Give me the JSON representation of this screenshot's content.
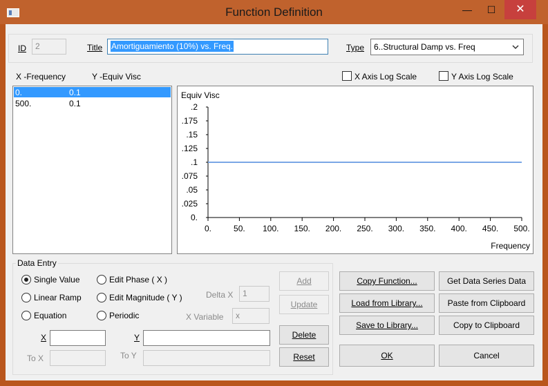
{
  "window": {
    "title": "Function Definition",
    "minimize_glyph": "—",
    "maximize_glyph": "☐",
    "close_glyph": "✕"
  },
  "header": {
    "id_label": "ID",
    "id_value": "2",
    "title_label": "Title",
    "title_value": "Amortiguamiento (10%) vs. Freq.",
    "type_label": "Type",
    "type_value": "6..Structural Damp vs. Freq"
  },
  "list": {
    "x_header": "X -Frequency",
    "y_header": "Y -Equiv Visc",
    "rows": [
      {
        "x": "0.",
        "y": "0.1"
      },
      {
        "x": "500.",
        "y": "0.1"
      }
    ],
    "selected_index": 0
  },
  "log_scale": {
    "x_label": "X Axis Log Scale",
    "x_checked": false,
    "y_label": "Y Axis Log Scale",
    "y_checked": false
  },
  "chart_data": {
    "type": "line",
    "title": "",
    "ylabel": "Equiv Visc",
    "xlabel": "Frequency",
    "x_ticks": [
      "0.",
      "50.",
      "100.",
      "150.",
      "200.",
      "250.",
      "300.",
      "350.",
      "400.",
      "450.",
      "500."
    ],
    "y_ticks": [
      "0.",
      ".025",
      ".05",
      ".075",
      ".1",
      ".125",
      ".15",
      ".175",
      ".2"
    ],
    "xlim": [
      0,
      500
    ],
    "ylim": [
      0,
      0.2
    ],
    "series": [
      {
        "x": [
          0,
          500
        ],
        "y": [
          0.1,
          0.1
        ],
        "color": "#7aa7e6"
      }
    ]
  },
  "data_entry": {
    "group_label": "Data Entry",
    "radios": [
      {
        "label": "Single Value",
        "checked": true
      },
      {
        "label": "Linear Ramp",
        "checked": false
      },
      {
        "label": "Equation",
        "checked": false
      },
      {
        "label": "Edit Phase ( X )",
        "checked": false
      },
      {
        "label": "Edit Magnitude ( Y )",
        "checked": false
      },
      {
        "label": "Periodic",
        "checked": false
      }
    ],
    "delta_x_label": "Delta X",
    "delta_x_value": "1",
    "x_variable_label": "X Variable",
    "x_variable_value": "x",
    "x_label": "X",
    "y_label": "Y",
    "to_x_label": "To X",
    "to_y_label": "To Y",
    "add": "Add",
    "update": "Update",
    "delete": "Delete",
    "reset": "Reset"
  },
  "buttons": {
    "copy_function": "Copy Function...",
    "get_data_series": "Get Data Series Data",
    "load_library": "Load from Library...",
    "paste_clipboard": "Paste from Clipboard",
    "save_library": "Save to Library...",
    "copy_clipboard": "Copy to Clipboard",
    "ok": "OK",
    "cancel": "Cancel"
  },
  "colors": {
    "titlebar": "#c0622d",
    "close": "#c7403d",
    "selection": "#3399ff",
    "series": "#7aa7e6"
  }
}
